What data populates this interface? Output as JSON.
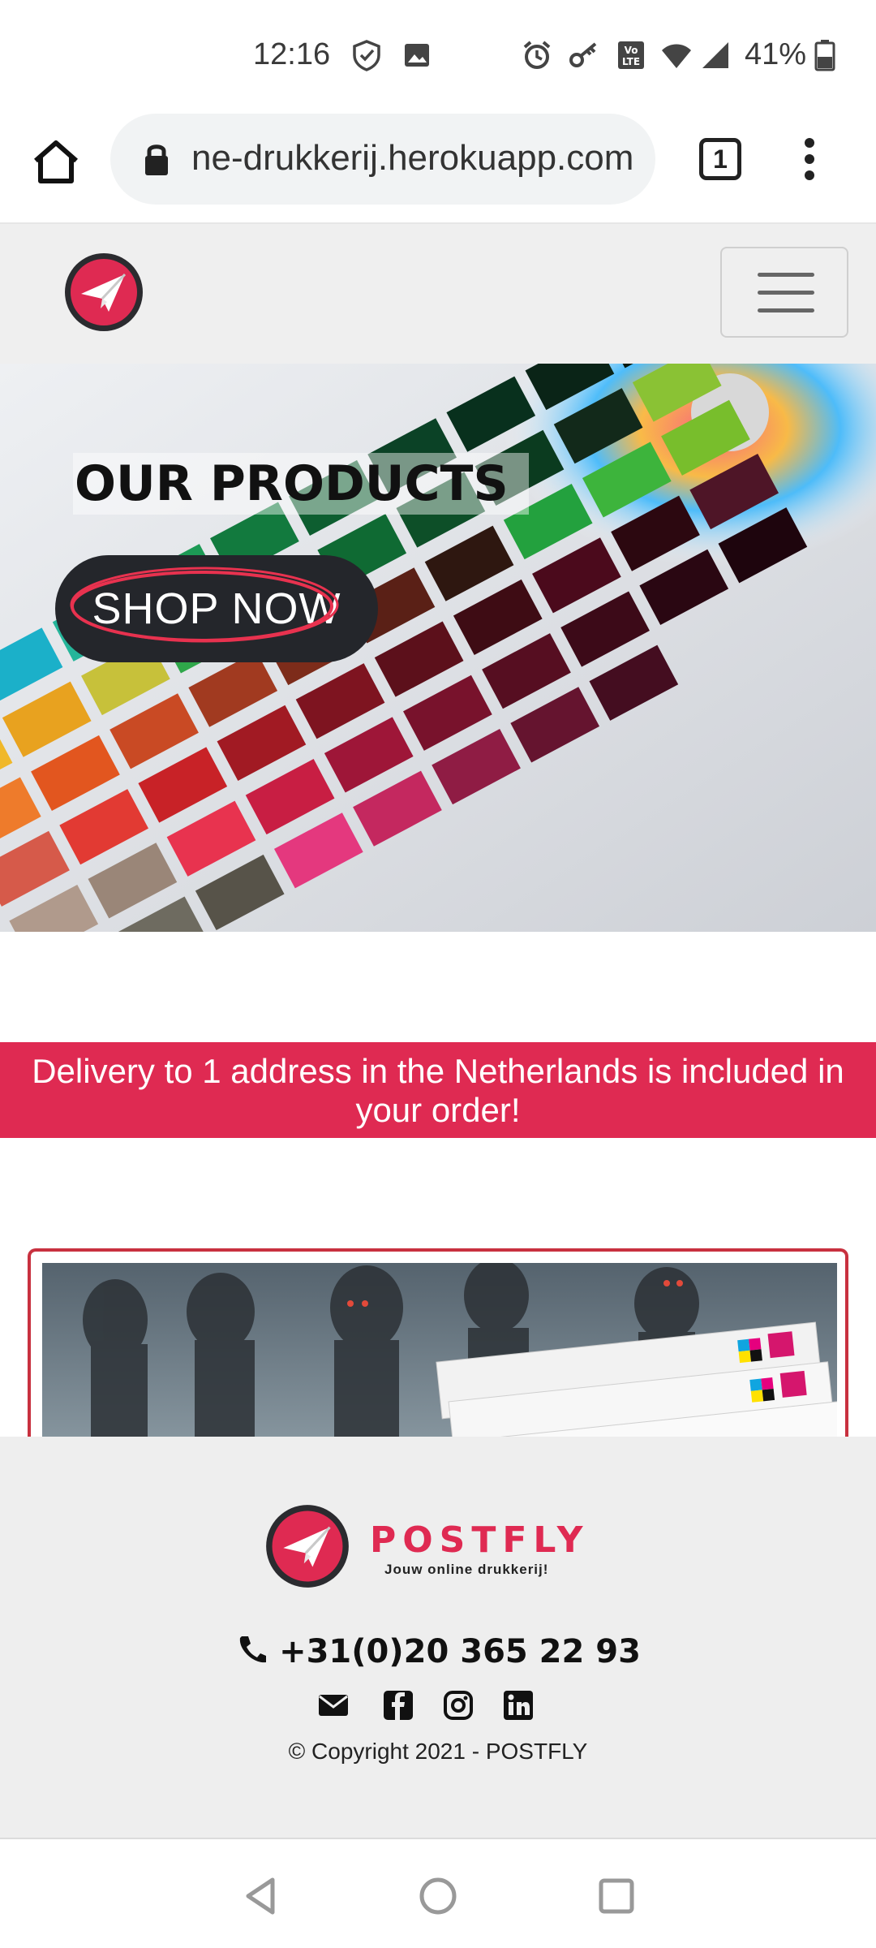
{
  "status_bar": {
    "time": "12:16",
    "battery_percent": "41%",
    "icons": [
      "shield-check-icon",
      "image-icon",
      "alarm-icon",
      "key-icon",
      "volte-icon",
      "wifi-icon",
      "signal-icon",
      "battery-icon"
    ]
  },
  "browser": {
    "url": "ne-drukkerij.herokuapp.com",
    "tab_count": "1"
  },
  "site_nav": {
    "logo": "paper-plane-logo",
    "menu": "hamburger-menu-icon"
  },
  "hero": {
    "title": "OUR PRODUCTS",
    "cta_label": "SHOP NOW"
  },
  "delivery_banner": {
    "text": "Delivery to 1 address in the Netherlands is included in your order!"
  },
  "footer": {
    "brand": "POSTFLY",
    "tagline": "Jouw online drukkerij!",
    "phone": "+31(0)20 365 22 93",
    "socials": [
      "envelope-icon",
      "facebook-icon",
      "instagram-icon",
      "linkedin-icon"
    ],
    "copyright": "© Copyright 2021 - POSTFLY"
  },
  "colors": {
    "brand_red": "#df2a52",
    "dark_button": "#24262b",
    "footer_bg": "#eeeeee"
  }
}
